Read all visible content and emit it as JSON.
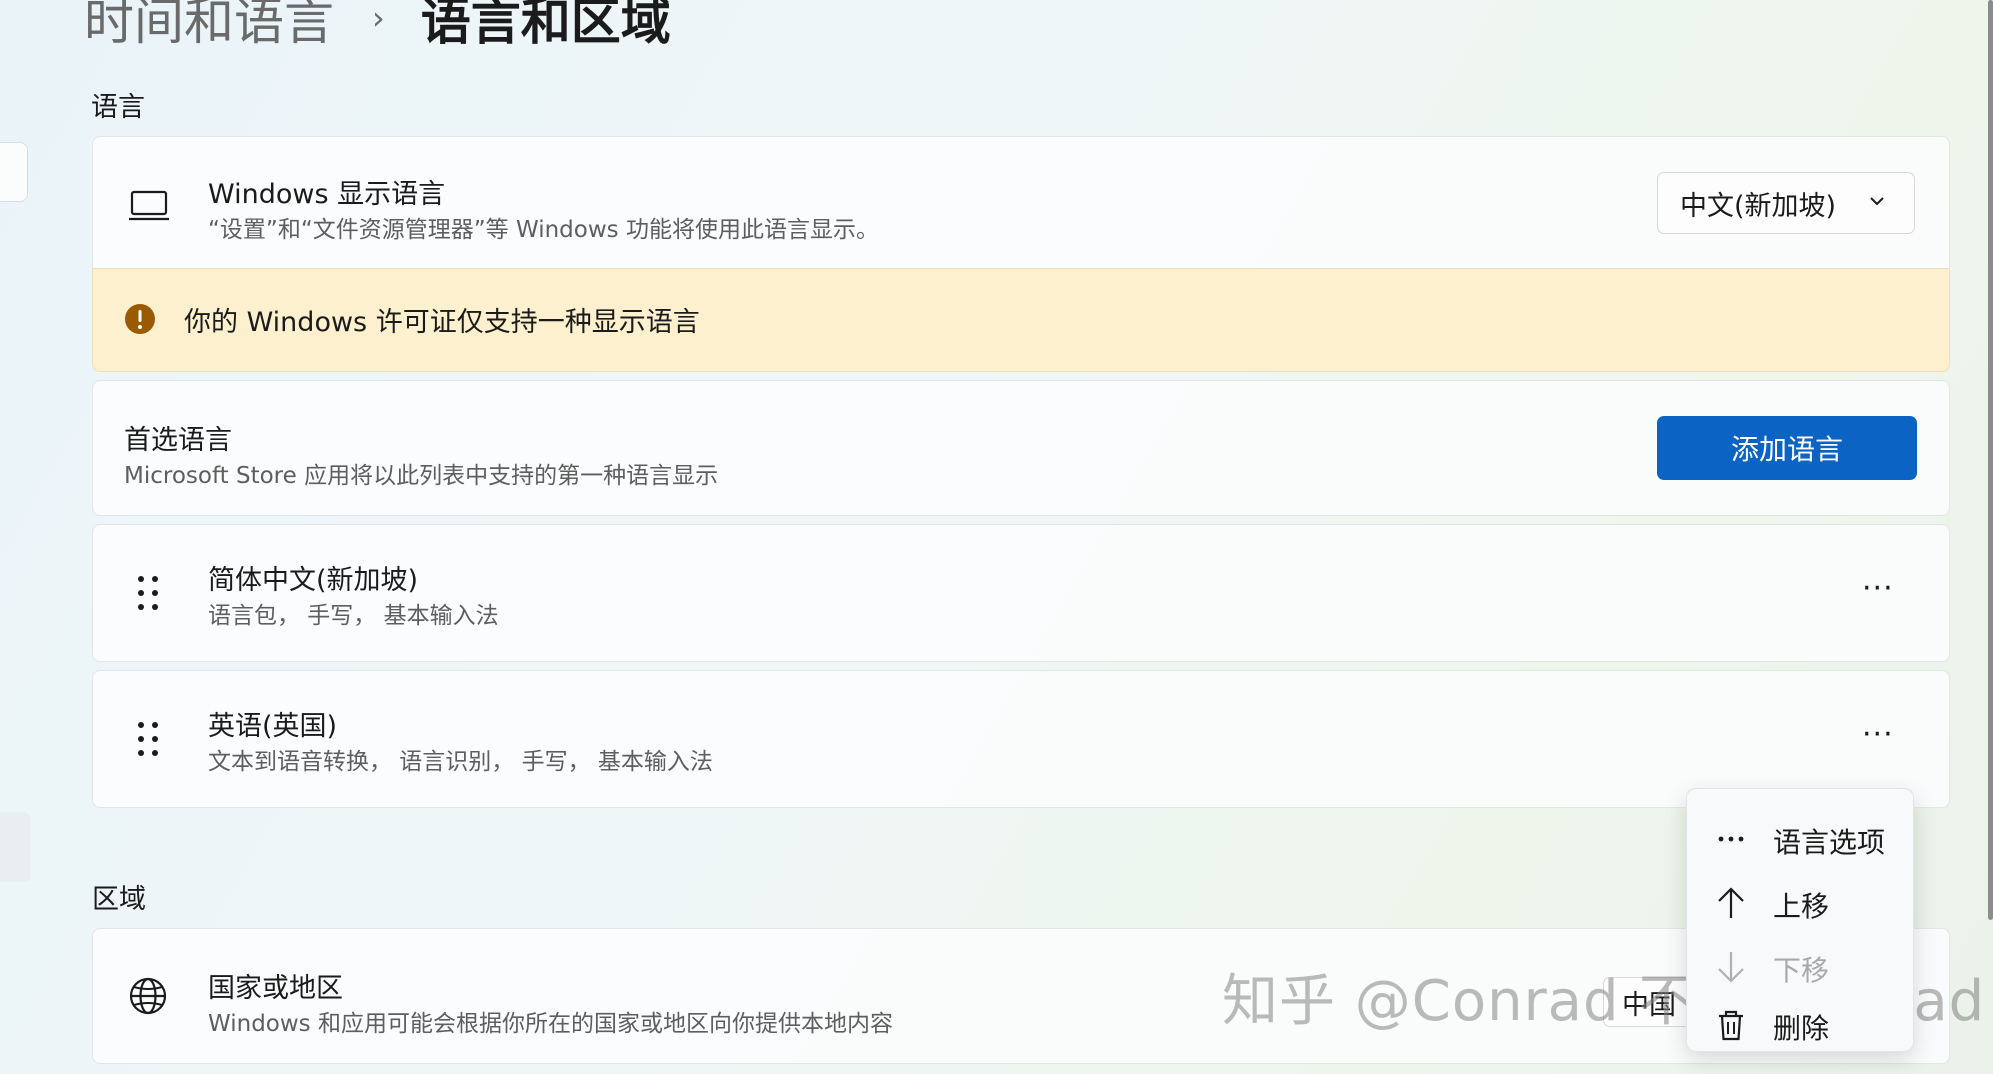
{
  "breadcrumb": {
    "parent": "时间和语言",
    "separator": "›",
    "current": "语言和区域"
  },
  "language_section": {
    "label": "语言",
    "display_language": {
      "title": "Windows 显示语言",
      "subtitle": "“设置”和“文件资源管理器”等 Windows 功能将使用此语言显示。",
      "selected": "中文(新加坡)",
      "icon": "laptop-icon"
    },
    "warning": {
      "icon": "warning-icon",
      "text": "你的 Windows 许可证仅支持一种显示语言",
      "color": "#9a5a00"
    },
    "preferred": {
      "title": "首选语言",
      "subtitle": "Microsoft Store 应用将以此列表中支持的第一种语言显示",
      "add_button": "添加语言",
      "accent": "#0b63c4"
    },
    "languages": [
      {
        "name": "简体中文(新加坡)",
        "features": "语言包， 手写， 基本输入法",
        "more": "···"
      },
      {
        "name": "英语(英国)",
        "features": "文本到语音转换， 语言识别， 手写， 基本输入法",
        "more": "···"
      }
    ]
  },
  "context_menu": {
    "items": [
      {
        "icon": "more-icon",
        "label": "语言选项",
        "enabled": true
      },
      {
        "icon": "arrow-up-icon",
        "label": "上移",
        "enabled": true
      },
      {
        "icon": "arrow-down-icon",
        "label": "下移",
        "enabled": false
      },
      {
        "icon": "trash-icon",
        "label": "删除",
        "enabled": true
      }
    ]
  },
  "region_section": {
    "label": "区域",
    "country": {
      "title": "国家或地区",
      "subtitle": "Windows 和应用可能会根据你所在的国家或地区向你提供本地内容",
      "selected": "中国",
      "icon": "globe-icon"
    }
  },
  "watermark": "知乎 @Conrad 不读 conRad"
}
